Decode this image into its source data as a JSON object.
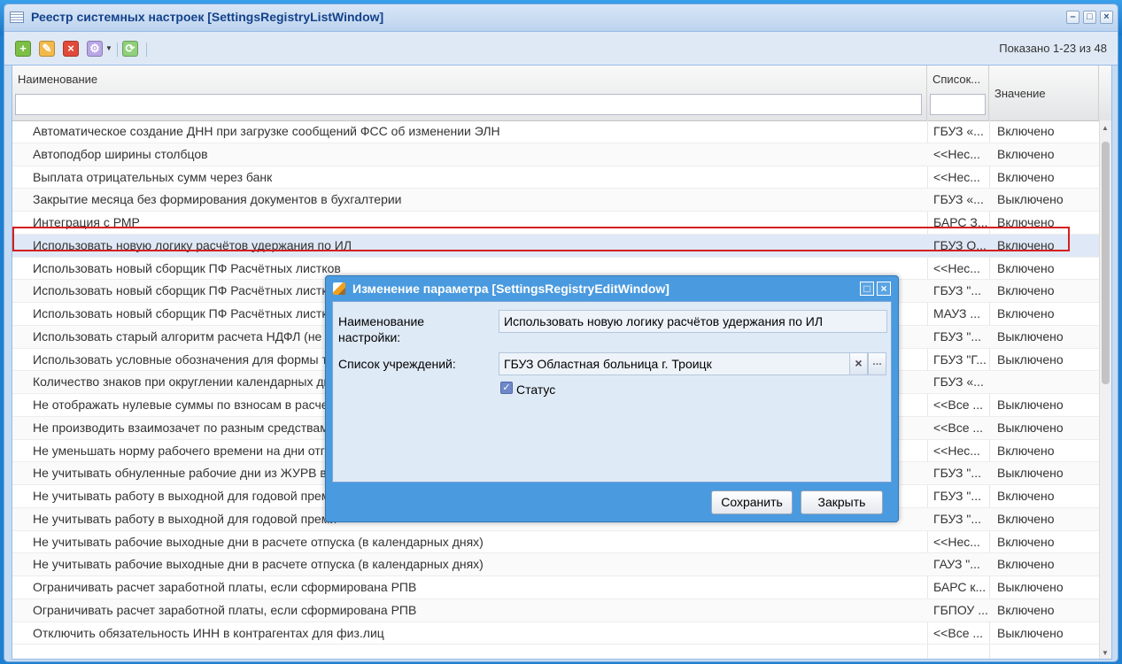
{
  "window": {
    "title": "Реестр системных настроек [SettingsRegistryListWindow]"
  },
  "toolbar": {
    "shown": "Показано 1-23 из 48"
  },
  "grid": {
    "columns": [
      "Наименование",
      "Список...",
      "Значение"
    ],
    "rows": [
      {
        "name": "Автоматическое создание ДНН при загрузке сообщений ФСС об изменении ЭЛН",
        "list": "ГБУЗ «...",
        "value": "Включено"
      },
      {
        "name": "Автоподбор ширины столбцов",
        "list": "<<Нес...",
        "value": "Включено"
      },
      {
        "name": "Выплата отрицательных сумм через банк",
        "list": "<<Нес...",
        "value": "Включено"
      },
      {
        "name": "Закрытие месяца без формирования документов в бухгалтерии",
        "list": "ГБУЗ «...",
        "value": "Выключено"
      },
      {
        "name": "Интеграция с РМР",
        "list": "БАРС З...",
        "value": "Включено"
      },
      {
        "name": "Использовать новую логику расчётов удержания по ИЛ",
        "list": "ГБУЗ О...",
        "value": "Включено"
      },
      {
        "name": "Использовать новый сборщик ПФ Расчётных листков",
        "list": "<<Нес...",
        "value": "Включено"
      },
      {
        "name": "Использовать новый сборщик ПФ Расчётных листков",
        "list": "ГБУЗ \"...",
        "value": "Включено"
      },
      {
        "name": "Использовать новый сборщик ПФ Расчётных листков",
        "list": "МАУЗ ...",
        "value": "Включено"
      },
      {
        "name": "Использовать старый алгоритм расчета НДФЛ (не ре",
        "list": "ГБУЗ \"...",
        "value": "Выключено"
      },
      {
        "name": "Использовать условные обозначения для формы таб",
        "list": "ГБУЗ \"Г...",
        "value": "Выключено"
      },
      {
        "name": "Количество знаков при округлении календарных дне",
        "list": "ГБУЗ «...",
        "value": ""
      },
      {
        "name": "Не отображать нулевые суммы по взносам в расчете",
        "list": "<<Все ...",
        "value": "Выключено"
      },
      {
        "name": "Не производить взаимозачет по разным средствам",
        "list": "<<Все ...",
        "value": "Выключено"
      },
      {
        "name": "Не уменьшать норму рабочего времени на дни отгул",
        "list": "<<Нес...",
        "value": "Включено"
      },
      {
        "name": "Не учитывать обнуленные рабочие дни из ЖУРВ в р",
        "list": "ГБУЗ \"...",
        "value": "Выключено"
      },
      {
        "name": "Не учитывать работу в выходной для годовой преми",
        "list": "ГБУЗ \"...",
        "value": "Включено"
      },
      {
        "name": "Не учитывать работу в выходной для годовой преми",
        "list": "ГБУЗ \"...",
        "value": "Включено"
      },
      {
        "name": "Не учитывать рабочие выходные дни в расчете отпуска (в календарных днях)",
        "list": "<<Нес...",
        "value": "Включено"
      },
      {
        "name": "Не учитывать рабочие выходные дни в расчете отпуска (в календарных днях)",
        "list": "ГАУЗ \"...",
        "value": "Включено"
      },
      {
        "name": "Ограничивать расчет заработной платы, если сформирована РПВ",
        "list": "БАРС к...",
        "value": "Выключено"
      },
      {
        "name": "Ограничивать расчет заработной платы, если сформирована РПВ",
        "list": "ГБПОУ ...",
        "value": "Включено"
      },
      {
        "name": "Отключить обязательность ИНН в контрагентах для физ.лиц",
        "list": "<<Все ...",
        "value": "Выключено"
      }
    ]
  },
  "dialog": {
    "title": "Изменение параметра [SettingsRegistryEditWindow]",
    "name_label": "Наименование настройки:",
    "name_value": "Использовать новую логику расчётов удержания по ИЛ",
    "list_label": "Список учреждений:",
    "list_value": "ГБУЗ Областная больница  г. Троицк",
    "status_label": "Статус",
    "status_checked": true,
    "save_label": "Сохранить",
    "close_label": "Закрыть"
  }
}
